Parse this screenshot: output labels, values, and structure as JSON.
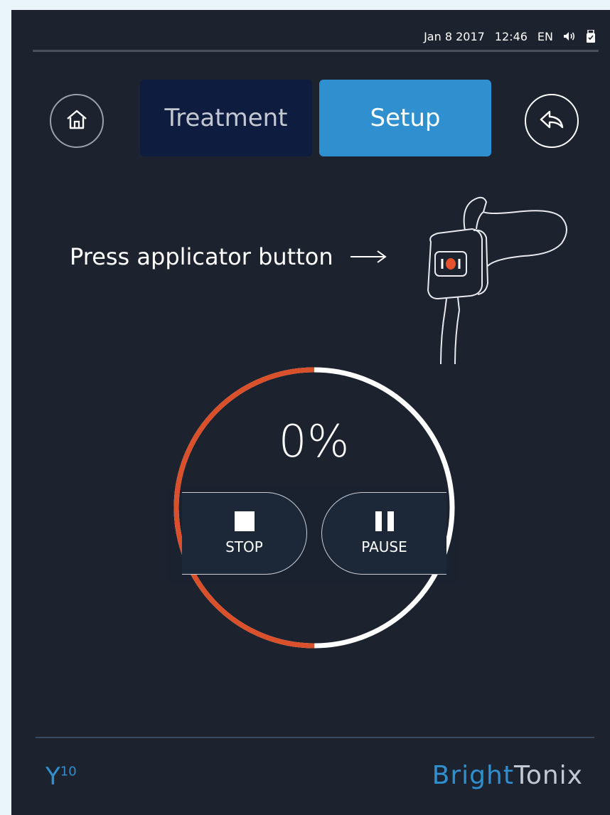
{
  "status": {
    "date": "Jan 8 2017",
    "time": "12:46",
    "language": "EN",
    "icons": [
      "volume-icon",
      "usb-icon"
    ]
  },
  "nav": {
    "home_icon": "home-icon",
    "back_icon": "back-arrow-icon",
    "tabs": [
      {
        "label": "Treatment",
        "active": false
      },
      {
        "label": "Setup",
        "active": true
      }
    ]
  },
  "instruction": {
    "text": "Press applicator button",
    "arrow": "→",
    "illustration": "applicator-illustration"
  },
  "progress": {
    "percent_label": "0%",
    "fill_fraction": 0.5
  },
  "controls": {
    "stop_label": "STOP",
    "pause_label": "PAUSE"
  },
  "footer": {
    "model_logo": "Y",
    "model_sup": "10",
    "brand_part1": "Bright",
    "brand_part2": "Tonix"
  },
  "colors": {
    "background": "#1d222f",
    "accent_blue": "#2f8fcf",
    "active_tab": "#2f8fcf",
    "inactive_tab": "#0e1c3f",
    "progress_orange": "#d9502a",
    "ring_white": "#ffffff"
  }
}
